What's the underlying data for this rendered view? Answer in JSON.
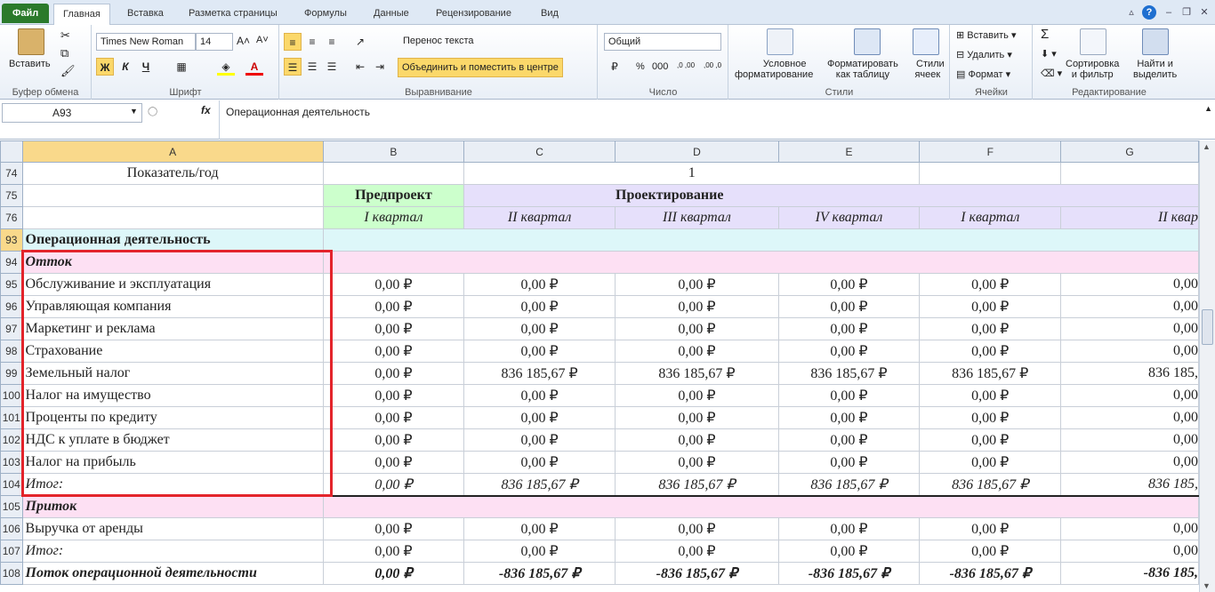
{
  "tabs": [
    "Файл",
    "Главная",
    "Вставка",
    "Разметка страницы",
    "Формулы",
    "Данные",
    "Рецензирование",
    "Вид"
  ],
  "ribbon": {
    "clipboard": {
      "paste": "Вставить",
      "label": "Буфер обмена"
    },
    "font": {
      "name": "Times New Roman",
      "size": "14",
      "bold": "Ж",
      "italic": "К",
      "underline": "Ч",
      "label": "Шрифт"
    },
    "alignment": {
      "wrap": "Перенос текста",
      "merge": "Объединить и поместить в центре",
      "label": "Выравнивание"
    },
    "number": {
      "format": "Общий",
      "percent": "%",
      "thousands": "000",
      "inc": ",0 ,00",
      "dec": ",00 ,0",
      "label": "Число"
    },
    "styles": {
      "conditional": [
        "Условное",
        "форматирование"
      ],
      "table": [
        "Форматировать",
        "как таблицу"
      ],
      "cell": [
        "Стили",
        "ячеек"
      ],
      "label": "Стили"
    },
    "cells": {
      "insert": "Вставить",
      "delete": "Удалить",
      "format": "Формат",
      "label": "Ячейки"
    },
    "editing": {
      "sum": "Σ",
      "sort": [
        "Сортировка",
        "и фильтр"
      ],
      "find": [
        "Найти и",
        "выделить"
      ],
      "label": "Редактирование"
    }
  },
  "formula_bar": {
    "cell": "A93",
    "fx": "fx",
    "content": "Операционная деятельность"
  },
  "columns": [
    "A",
    "B",
    "C",
    "D",
    "E",
    "F",
    "G"
  ],
  "header_rows": {
    "r74": {
      "num": "74",
      "a": "Показатель/год",
      "year": "1"
    },
    "r75": {
      "num": "75",
      "b": "Предпроект",
      "c": "Проектирование"
    },
    "r76": {
      "num": "76",
      "b": "I квартал",
      "c": "II квартал",
      "d": "III квартал",
      "e": "IV квартал",
      "f": "I квартал",
      "g": "II квар"
    }
  },
  "rows": [
    {
      "num": "93",
      "label": "Операционная деятельность",
      "type": "section"
    },
    {
      "num": "94",
      "label": "Отток",
      "type": "sub"
    },
    {
      "num": "95",
      "label": "Обслуживание и эксплуатация",
      "v": [
        "0,00 ₽",
        "0,00 ₽",
        "0,00 ₽",
        "0,00 ₽",
        "0,00 ₽",
        "0,00"
      ]
    },
    {
      "num": "96",
      "label": "Управляющая компания",
      "v": [
        "0,00 ₽",
        "0,00 ₽",
        "0,00 ₽",
        "0,00 ₽",
        "0,00 ₽",
        "0,00"
      ]
    },
    {
      "num": "97",
      "label": "Маркетинг и реклама",
      "v": [
        "0,00 ₽",
        "0,00 ₽",
        "0,00 ₽",
        "0,00 ₽",
        "0,00 ₽",
        "0,00"
      ]
    },
    {
      "num": "98",
      "label": "Страхование",
      "v": [
        "0,00 ₽",
        "0,00 ₽",
        "0,00 ₽",
        "0,00 ₽",
        "0,00 ₽",
        "0,00"
      ]
    },
    {
      "num": "99",
      "label": "Земельный налог",
      "v": [
        "0,00 ₽",
        "836 185,67 ₽",
        "836 185,67 ₽",
        "836 185,67 ₽",
        "836 185,67 ₽",
        "836 185,"
      ]
    },
    {
      "num": "100",
      "label": "Налог на имущество",
      "v": [
        "0,00 ₽",
        "0,00 ₽",
        "0,00 ₽",
        "0,00 ₽",
        "0,00 ₽",
        "0,00"
      ]
    },
    {
      "num": "101",
      "label": "Проценты по кредиту",
      "v": [
        "0,00 ₽",
        "0,00 ₽",
        "0,00 ₽",
        "0,00 ₽",
        "0,00 ₽",
        "0,00"
      ]
    },
    {
      "num": "102",
      "label": "НДС к уплате в бюджет",
      "v": [
        "0,00 ₽",
        "0,00 ₽",
        "0,00 ₽",
        "0,00 ₽",
        "0,00 ₽",
        "0,00"
      ]
    },
    {
      "num": "103",
      "label": "Налог на прибыль",
      "v": [
        "0,00 ₽",
        "0,00 ₽",
        "0,00 ₽",
        "0,00 ₽",
        "0,00 ₽",
        "0,00"
      ]
    },
    {
      "num": "104",
      "label": "Итог:",
      "type": "total",
      "v": [
        "0,00 ₽",
        "836 185,67 ₽",
        "836 185,67 ₽",
        "836 185,67 ₽",
        "836 185,67 ₽",
        "836 185,"
      ]
    },
    {
      "num": "105",
      "label": "Приток",
      "type": "sub"
    },
    {
      "num": "106",
      "label": "Выручка от аренды",
      "v": [
        "0,00 ₽",
        "0,00 ₽",
        "0,00 ₽",
        "0,00 ₽",
        "0,00 ₽",
        "0,00"
      ]
    },
    {
      "num": "107",
      "label": "Итог:",
      "type": "total2",
      "v": [
        "0,00 ₽",
        "0,00 ₽",
        "0,00 ₽",
        "0,00 ₽",
        "0,00 ₽",
        "0,00"
      ]
    },
    {
      "num": "108",
      "label": "Поток операционной деятельности",
      "type": "flow",
      "v": [
        "0,00 ₽",
        "-836 185,67 ₽",
        "-836 185,67 ₽",
        "-836 185,67 ₽",
        "-836 185,67 ₽",
        "-836 185,"
      ]
    }
  ]
}
